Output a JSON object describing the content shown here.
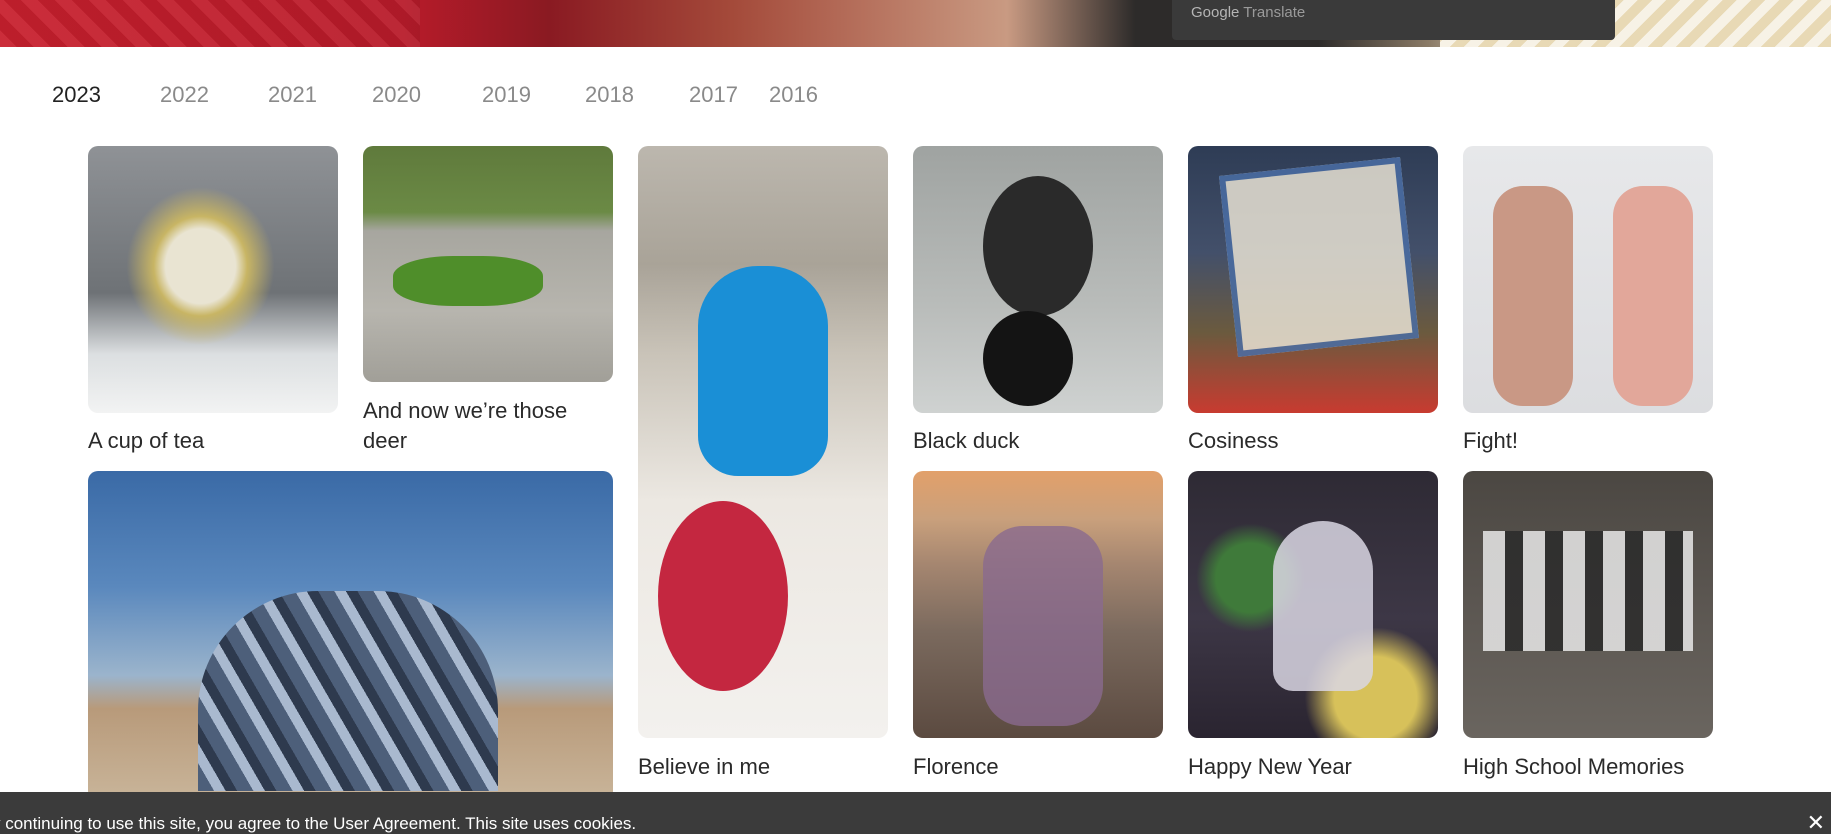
{
  "translate": {
    "brand": "Google",
    "label": "Translate"
  },
  "years": [
    "2023",
    "2022",
    "2021",
    "2020",
    "2019",
    "2018",
    "2017",
    "2016"
  ],
  "active_year": "2023",
  "gallery": [
    {
      "title": "A cup of tea"
    },
    {
      "title": "And now we’re those"
    },
    {
      "title": "deer"
    },
    {
      "title": "Believe in me"
    },
    {
      "title": "Black duck"
    },
    {
      "title": "Cosiness"
    },
    {
      "title": "Fight!"
    },
    {
      "title": "Florence"
    },
    {
      "title": "Happy New Year"
    },
    {
      "title": "High School Memories"
    }
  ],
  "cookie": {
    "text": "y continuing to use this site, you agree to the User Agreement. This site uses cookies.",
    "close_glyph": "✕"
  }
}
